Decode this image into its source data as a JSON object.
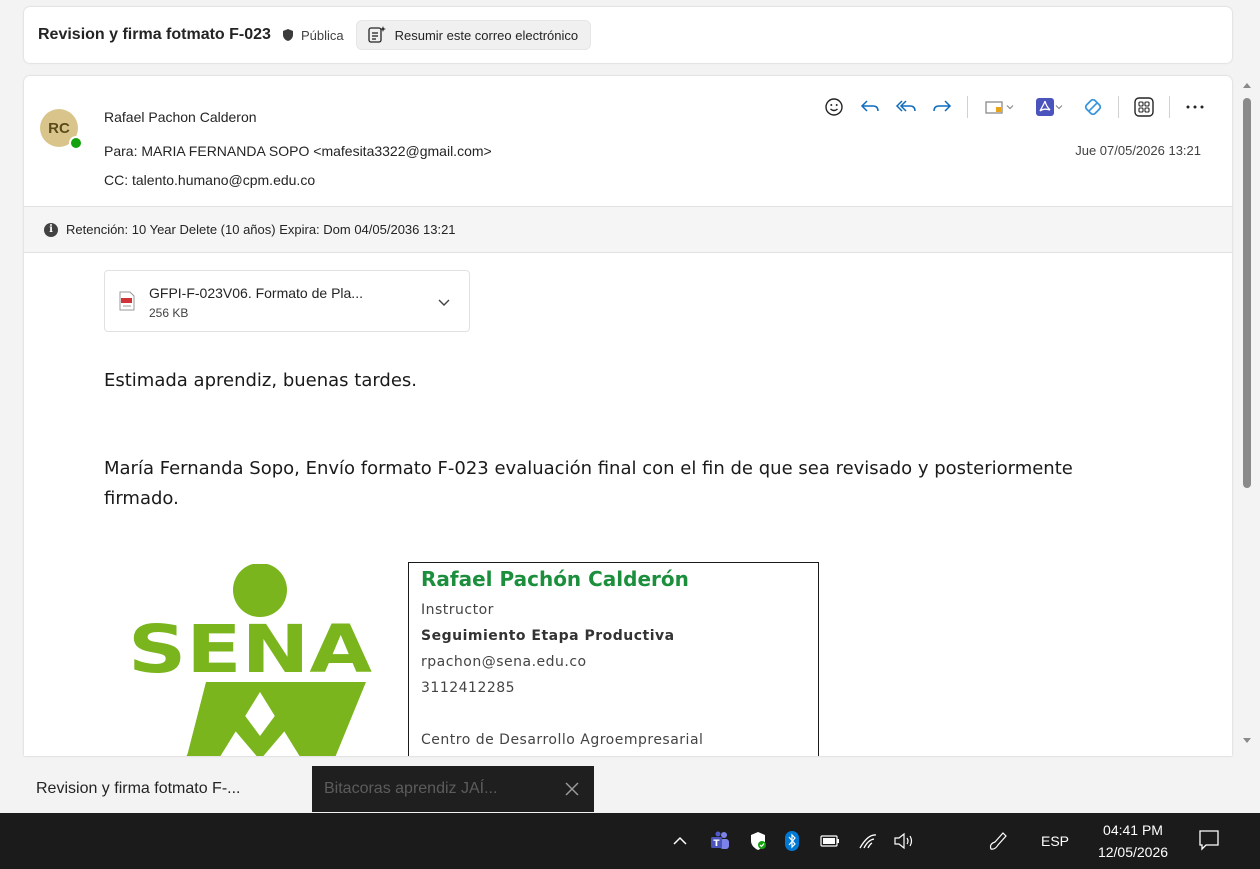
{
  "subject": {
    "title": "Revision y firma fotmato F-023",
    "visibility": "Pública",
    "summarize_label": "Resumir este correo electrónico"
  },
  "message": {
    "avatar_initials": "RC",
    "sender": "Rafael Pachon Calderon",
    "to": "Para:  MARIA FERNANDA SOPO <mafesita3322@gmail.com>",
    "cc": "CC:  talento.humano@cpm.edu.co",
    "date": "Jue 07/05/2026 13:21",
    "retention": "Retención: 10 Year Delete (10 años) Expira: Dom 04/05/2036 13:21",
    "attachment": {
      "name": "GFPI-F-023V06. Formato de Pla...",
      "size": "256 KB"
    },
    "greeting": "Estimada aprendiz, buenas tardes.",
    "body": "María Fernanda Sopo, Envío formato F-023 evaluación final con el fin de que sea revisado y posteriormente firmado."
  },
  "signature": {
    "logo_text": "SENA",
    "name": "Rafael Pachón Calderón",
    "role": "Instructor",
    "area": "Seguimiento Etapa Productiva",
    "email": "rpachon@sena.edu.co",
    "phone": "3112412285",
    "center": "Centro de Desarrollo Agroempresarial"
  },
  "tabs": {
    "active": "Revision y firma fotmato F-...",
    "other": "Bitacoras aprendiz JAÍ..."
  },
  "taskbar": {
    "language": "ESP",
    "time": "04:41 PM",
    "date": "12/05/2026"
  },
  "colors": {
    "accent": "#0f6cbd",
    "presence": "#13a10e",
    "sena_green": "#7ab51d",
    "signature_green": "#1b8f3c"
  }
}
